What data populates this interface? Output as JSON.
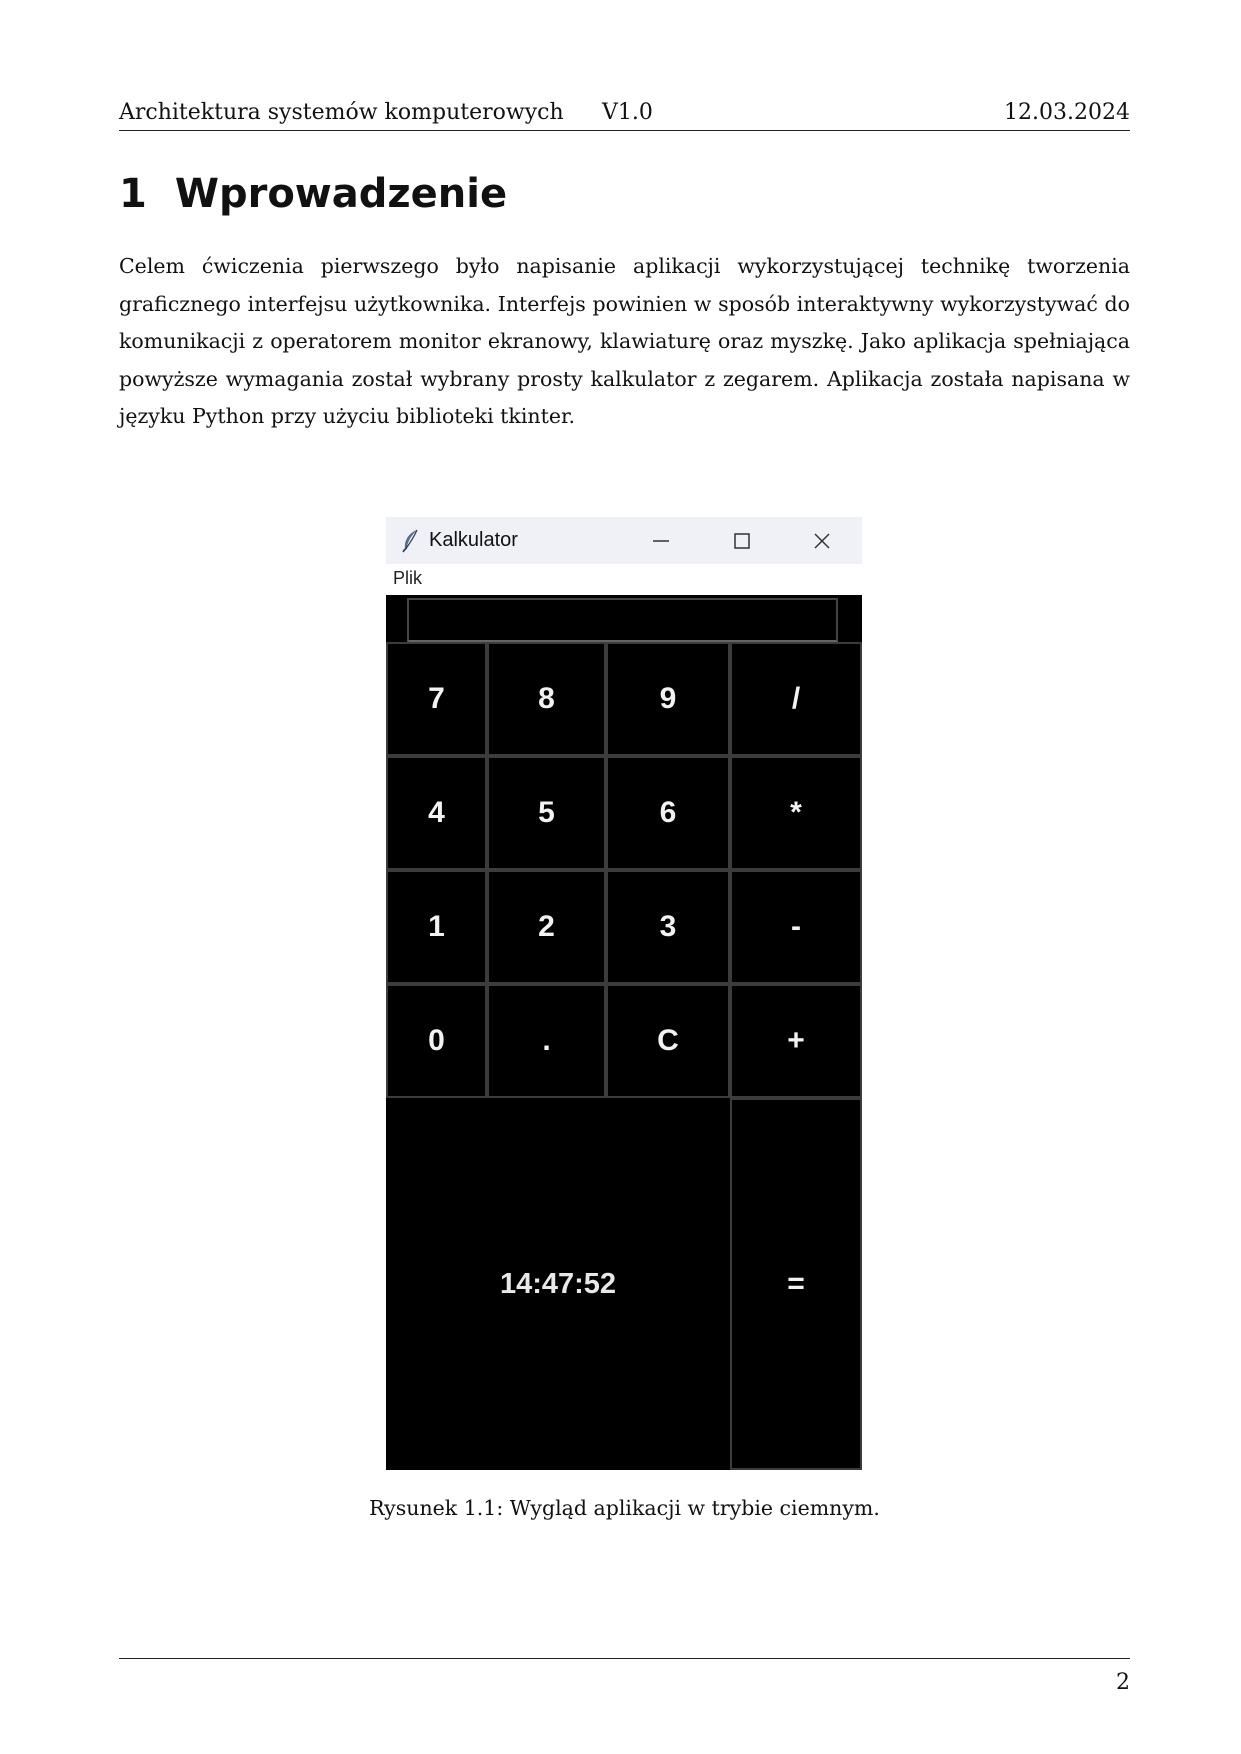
{
  "header": {
    "course": "Architektura systemów komputerowych",
    "version": "V1.0",
    "date": "12.03.2024"
  },
  "section": {
    "number": "1",
    "title": "Wprowadzenie"
  },
  "intro_paragraph": "Celem ćwiczenia pierwszego było napisanie aplikacji wykorzystującej technikę tworzenia graficznego interfejsu użytkownika. Interfejs powinien w sposób interaktywny wykorzystywać do komunikacji z operatorem monitor ekranowy, klawiaturę oraz myszkę. Jako aplikacja spełniająca powyższe wymagania został wybrany prosty kalkulator z zegarem. Aplikacja została napisana w języku Python przy użyciu biblioteki tkinter.",
  "app_window": {
    "title": "Kalkulator",
    "title_icon": "feather-icon",
    "controls": [
      "minimize-icon",
      "maximize-icon",
      "close-icon"
    ],
    "menu": [
      "Plik"
    ],
    "display_value": "",
    "keys": [
      [
        "7",
        "8",
        "9",
        "/"
      ],
      [
        "4",
        "5",
        "6",
        "*"
      ],
      [
        "1",
        "2",
        "3",
        "-"
      ],
      [
        "0",
        ".",
        "C",
        "+"
      ]
    ],
    "clock": "14:47:52",
    "equals_key": "=",
    "colors": {
      "background": "#000000",
      "key_text": "#f2f2f2",
      "key_border": "#3c3c3c",
      "titlebar": "#eff1f6"
    }
  },
  "figure_caption": "Rysunek 1.1: Wygląd aplikacji w trybie ciemnym.",
  "page_number": "2"
}
